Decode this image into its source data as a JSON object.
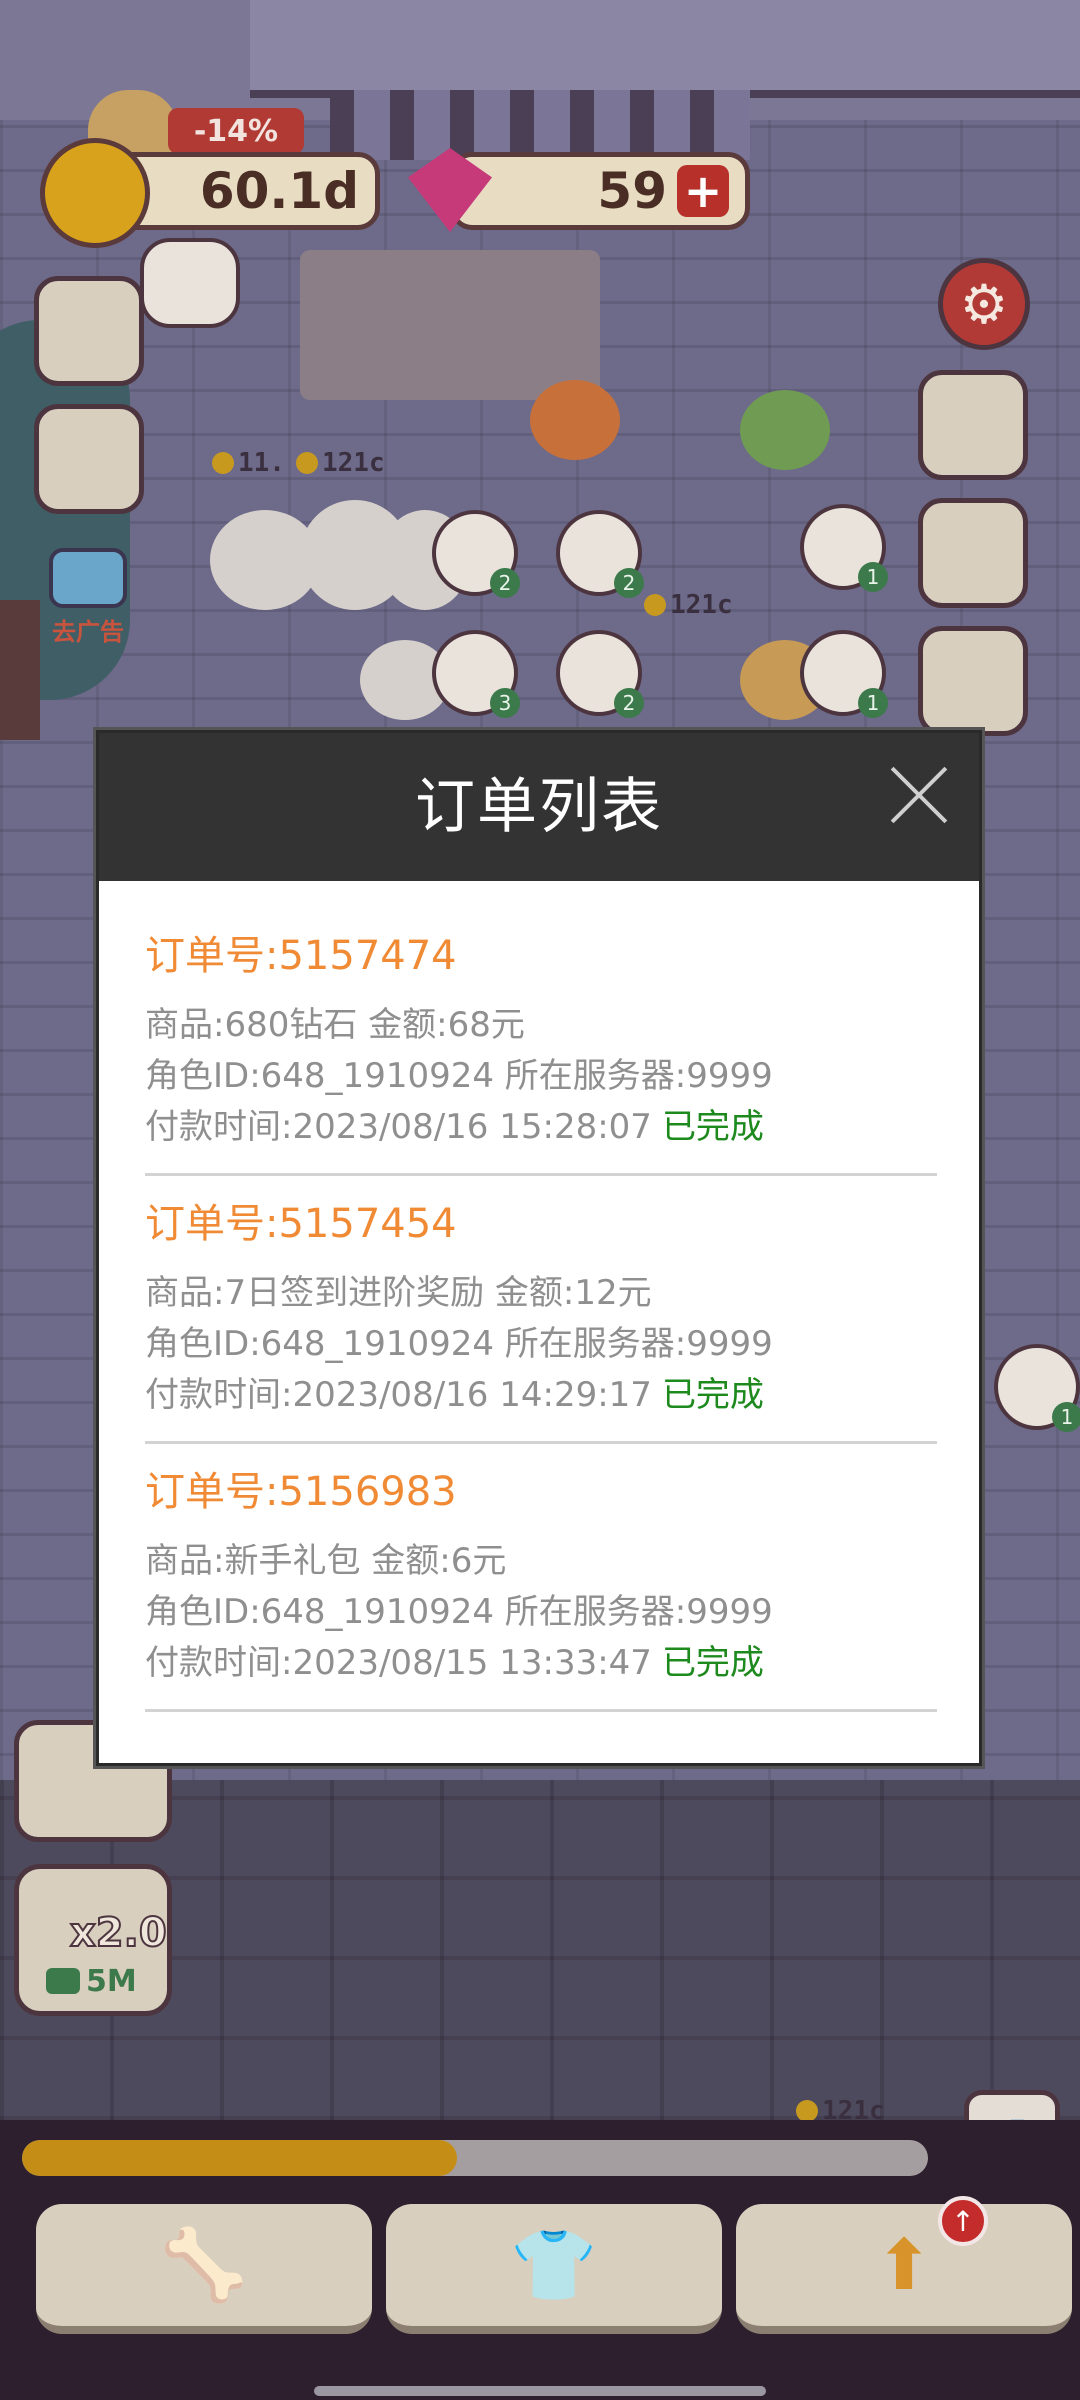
{
  "hud": {
    "coins": "60.1d",
    "gems": "59",
    "gem_plus": "+",
    "coin_change": "-14%"
  },
  "left_panel": {
    "no_ads_label": "去广告"
  },
  "floor_prices": [
    "11.",
    "121c",
    "121c",
    "121c"
  ],
  "bubble_counts": [
    "2",
    "2",
    "1",
    "3",
    "2",
    "1",
    "1"
  ],
  "multiplier": {
    "value": "x2.0",
    "sub": "5M"
  },
  "progress": {
    "fraction": 0.48
  },
  "modal": {
    "title": "订单列表",
    "orders": [
      {
        "order_no": "订单号:5157474",
        "product_line": "商品:680钻石 金额:68元",
        "role_line": "角色ID:648_1910924 所在服务器:9999",
        "time_line": "付款时间:2023/08/16 15:28:07",
        "status": "已完成"
      },
      {
        "order_no": "订单号:5157454",
        "product_line": "商品:7日签到进阶奖励 金额:12元",
        "role_line": "角色ID:648_1910924 所在服务器:9999",
        "time_line": "付款时间:2023/08/16 14:29:17",
        "status": "已完成"
      },
      {
        "order_no": "订单号:5156983",
        "product_line": "商品:新手礼包 金额:6元",
        "role_line": "角色ID:648_1910924 所在服务器:9999",
        "time_line": "付款时间:2023/08/15 13:33:47",
        "status": "已完成"
      }
    ]
  },
  "bottom_nav": [
    {
      "icon": "bone-icon"
    },
    {
      "icon": "shirt-icon"
    },
    {
      "icon": "upgrade-arrow-icon",
      "badge_icon": "up-arrow-badge-icon"
    }
  ],
  "colors": {
    "modal_header": "#333333",
    "order_id": "#f08a34",
    "status_done": "#1e8a1e",
    "detail_text": "#8f8f8f"
  }
}
